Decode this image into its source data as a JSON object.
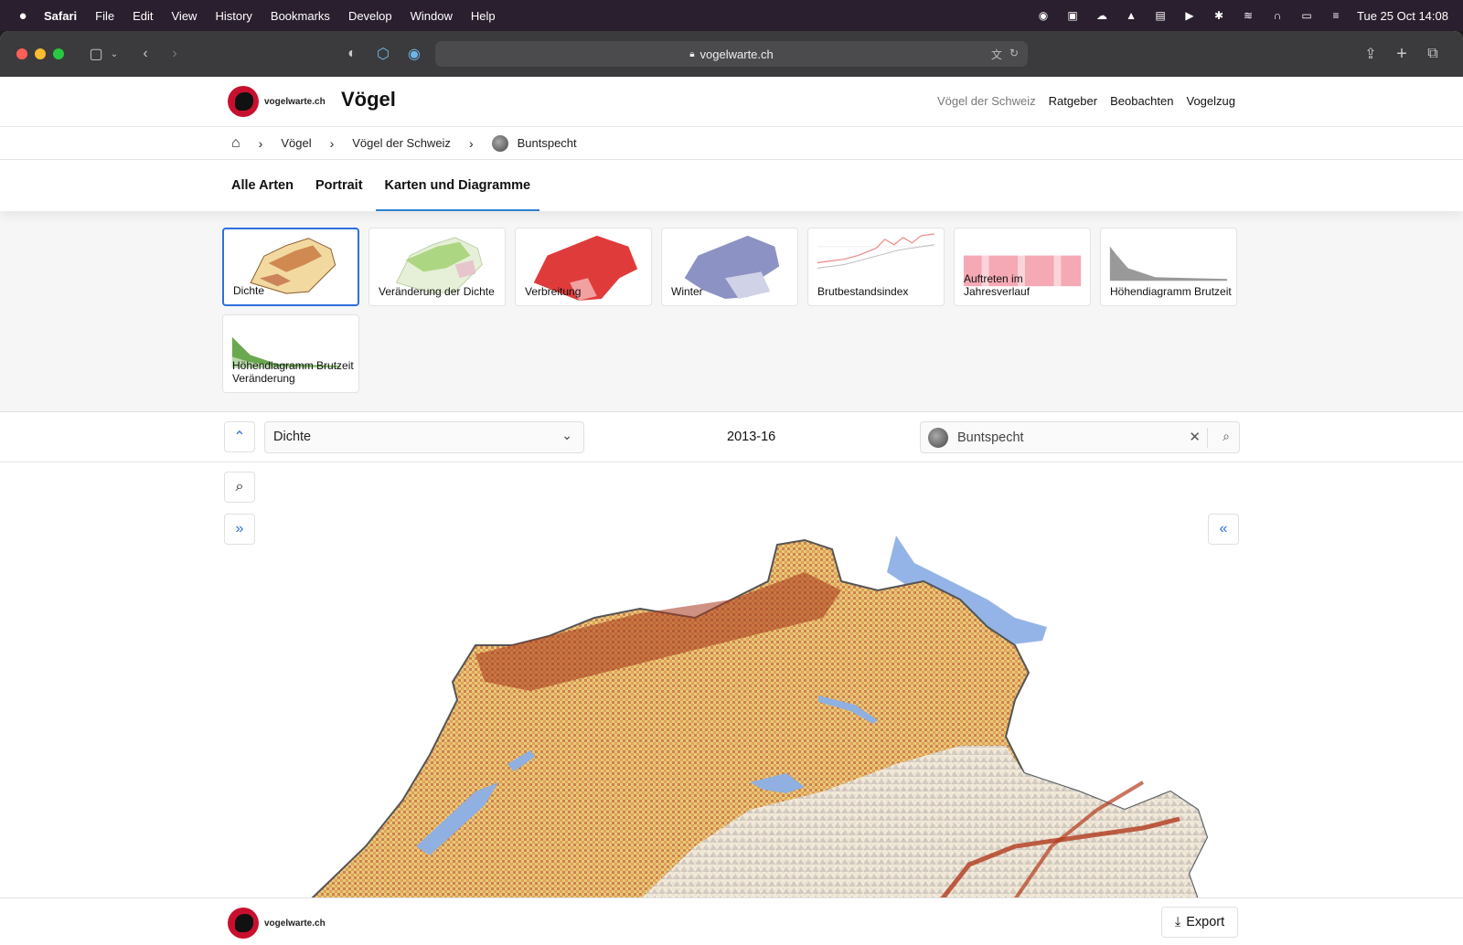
{
  "macbar": {
    "apple": "",
    "menus": [
      "Safari",
      "File",
      "Edit",
      "View",
      "History",
      "Bookmarks",
      "Develop",
      "Window",
      "Help"
    ],
    "clock": "Tue 25 Oct  14:08"
  },
  "browser": {
    "url": "vogelwarte.ch"
  },
  "header": {
    "logo_text": "vogelwarte.ch",
    "title": "Vögel",
    "nav": [
      "Vögel der Schweiz",
      "Ratgeber",
      "Beobachten",
      "Vogelzug"
    ]
  },
  "breadcrumb": {
    "items": [
      "Vögel",
      "Vögel der Schweiz",
      "Buntspecht"
    ]
  },
  "tabs": [
    "Alle Arten",
    "Portrait",
    "Karten und Diagramme"
  ],
  "gallery": {
    "cards": [
      {
        "label": "Dichte"
      },
      {
        "label": "Veränderung der Dichte"
      },
      {
        "label": "Verbreitung"
      },
      {
        "label": "Winter"
      },
      {
        "label": "Brutbestandsindex"
      },
      {
        "label": "Auftreten im Jahresverlauf"
      },
      {
        "label": "Höhendiagramm Brutzeit"
      },
      {
        "label": "Höhendiagramm Brutzeit Veränderung"
      }
    ]
  },
  "controls": {
    "map_type": "Dichte",
    "period": "2013-16",
    "species": "Buntspecht"
  },
  "footer": {
    "logo_text": "vogelwarte.ch",
    "export_label": "Export"
  },
  "colors": {
    "accent": "#2f6fdd",
    "brand_red": "#c8102e"
  }
}
